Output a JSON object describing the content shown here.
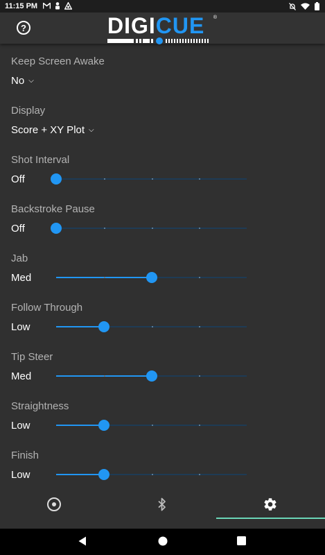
{
  "status_bar": {
    "time": "11:15 PM",
    "left_icons": [
      "gmail-icon",
      "person-alert-icon",
      "signal-relay-icon"
    ],
    "right_icons": [
      "notifications-off-icon",
      "wifi-icon",
      "battery-icon"
    ]
  },
  "header": {
    "logo_part1": "DIGI",
    "logo_part2": "CUE",
    "logo_mark": "®",
    "help_icon": "help-circle-icon"
  },
  "settings": [
    {
      "label": "Keep Screen Awake",
      "type": "dropdown",
      "value": "No"
    },
    {
      "label": "Display",
      "type": "dropdown",
      "value": "Score + XY Plot"
    },
    {
      "label": "Shot Interval",
      "type": "slider",
      "value": "Off",
      "position": 0
    },
    {
      "label": "Backstroke Pause",
      "type": "slider",
      "value": "Off",
      "position": 0
    },
    {
      "label": "Jab",
      "type": "slider",
      "value": "Med",
      "position": 0.5
    },
    {
      "label": "Follow Through",
      "type": "slider",
      "value": "Low",
      "position": 0.25
    },
    {
      "label": "Tip Steer",
      "type": "slider",
      "value": "Med",
      "position": 0.5
    },
    {
      "label": "Straightness",
      "type": "slider",
      "value": "Low",
      "position": 0.25
    },
    {
      "label": "Finish",
      "type": "slider",
      "value": "Low",
      "position": 0.25
    }
  ],
  "bottom_nav": {
    "items": [
      {
        "icon": "target-icon",
        "active": false
      },
      {
        "icon": "bluetooth-icon",
        "active": false
      },
      {
        "icon": "settings-gear-icon",
        "active": true
      }
    ]
  },
  "system_nav": [
    "back-icon",
    "home-icon",
    "recents-icon"
  ],
  "colors": {
    "background": "#303030",
    "accent": "#2196f3",
    "active_tab_indicator": "#6ad7b8",
    "label_text": "#b3b3b3"
  }
}
